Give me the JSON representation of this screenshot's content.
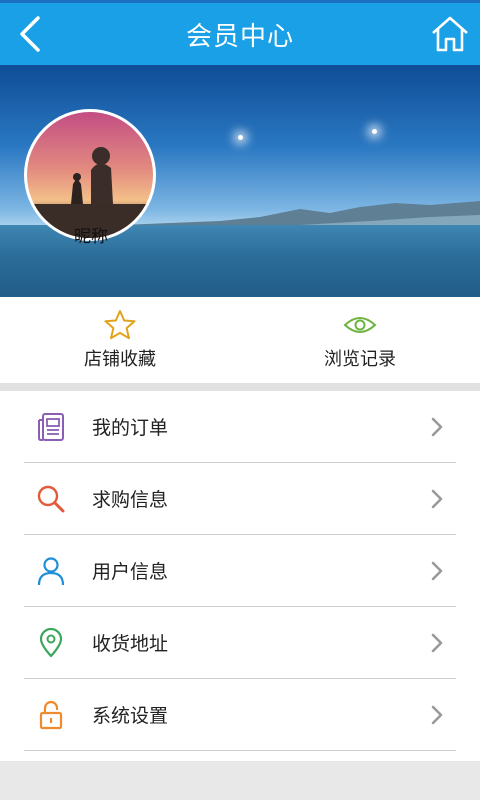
{
  "header": {
    "title": "会员中心",
    "back_icon": "chevron-left-icon",
    "home_icon": "home-icon"
  },
  "profile": {
    "nickname": "昵称"
  },
  "quick_actions": [
    {
      "label": "店铺收藏",
      "icon": "star-icon",
      "color": "#e2a31c"
    },
    {
      "label": "浏览记录",
      "icon": "eye-icon",
      "color": "#6db33f"
    }
  ],
  "menu": [
    {
      "label": "我的订单",
      "icon": "order-list-icon",
      "color": "#8a5fb3"
    },
    {
      "label": "求购信息",
      "icon": "search-icon",
      "color": "#e15a3c"
    },
    {
      "label": "用户信息",
      "icon": "user-icon",
      "color": "#1e8fd8"
    },
    {
      "label": "收货地址",
      "icon": "location-pin-icon",
      "color": "#3aa75a"
    },
    {
      "label": "系统设置",
      "icon": "lock-icon",
      "color": "#ef8a2e"
    }
  ],
  "colors": {
    "header_bg": "#1aa0e6",
    "chevron": "#9a9a9a"
  }
}
